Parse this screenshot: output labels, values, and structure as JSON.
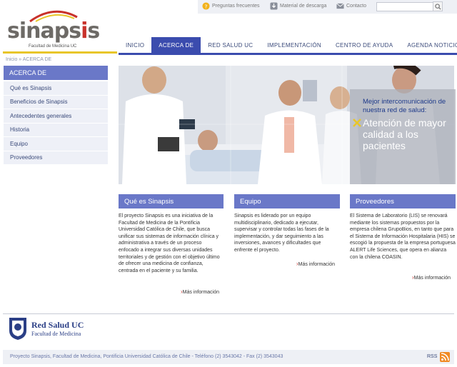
{
  "brand": {
    "name_part1": "sinaps",
    "name_part2": "i",
    "name_part3": "s",
    "subtitle": "Facultad de Medicina UC"
  },
  "utility": {
    "faq": "Preguntas frecuentes",
    "downloads": "Material de descarga",
    "contact": "Contacto"
  },
  "nav": {
    "items": [
      {
        "label": "INICIO"
      },
      {
        "label": "ACERCA DE"
      },
      {
        "label": "RED SALUD UC"
      },
      {
        "label": "IMPLEMENTACIÓN"
      },
      {
        "label": "CENTRO DE AYUDA"
      },
      {
        "label": "AGENDA NOTICIOSA"
      }
    ],
    "active_index": 1
  },
  "breadcrumb": {
    "home": "Inicio",
    "separator": "»",
    "current": "ACERCA DE"
  },
  "sidebar": {
    "title": "ACERCA DE",
    "items": [
      {
        "label": "Qué es Sinapsis"
      },
      {
        "label": "Beneficios de Sinapsis"
      },
      {
        "label": "Antecedentes generales"
      },
      {
        "label": "Historia"
      },
      {
        "label": "Equipo"
      },
      {
        "label": "Proveedores"
      }
    ]
  },
  "hero": {
    "caption_small": "Mejor intercomunicación de nuestra red de salud:",
    "caption_big": "Atención de mayor calidad a los pacientes"
  },
  "columns": [
    {
      "title": "Qué es Sinapsis",
      "text": "El proyecto Sinapsis es una iniciativa de la Facultad de Medicina de la Pontificia Universidad Católica de Chile, que busca unificar sus sistemas de información clínica y administrativa a través de un proceso enfocado a integrar sus diversas unidades territoriales y de gestión con el objetivo último de ofrecer una medicina de confianza, centrada en el paciente y su familia.",
      "more": "Más información"
    },
    {
      "title": "Equipo",
      "text": "Sinapsis es liderado por un equipo multidisciplinario, dedicado a ejecutar, supervisar y controlar todas las fases de la implementación, y dar seguimiento a las inversiones, avances y dificultades que enfrente el proyecto.",
      "more": "Más información"
    },
    {
      "title": "Proveedores",
      "text": "El Sistema de Laboratorio (LIS) se renovará mediante los sistemas propuestos por la empresa chilena GrupoBios, en tanto que para el Sistema de Información Hospitalaria (HIS) se escogió la propuesta de la empresa portuguesa ALERT Life Sciences, que opera en alianza con la chilena COASIN.",
      "more": "Más información"
    }
  ],
  "footer": {
    "logo_title": "Red Salud UC",
    "logo_sub": "Facultad de Medicina",
    "address": "Proyecto Sinapsis, Facultad de Medicina, Pontificia Universidad Católica de Chile - Teléfono (2) 3543042 - Fax (2) 3543043",
    "rss": "RSS"
  },
  "colors": {
    "accent": "#3b4cae",
    "sidebar_head": "#6a78c8",
    "brand_red": "#c8322b",
    "brand_yellow": "#e8c62a"
  }
}
